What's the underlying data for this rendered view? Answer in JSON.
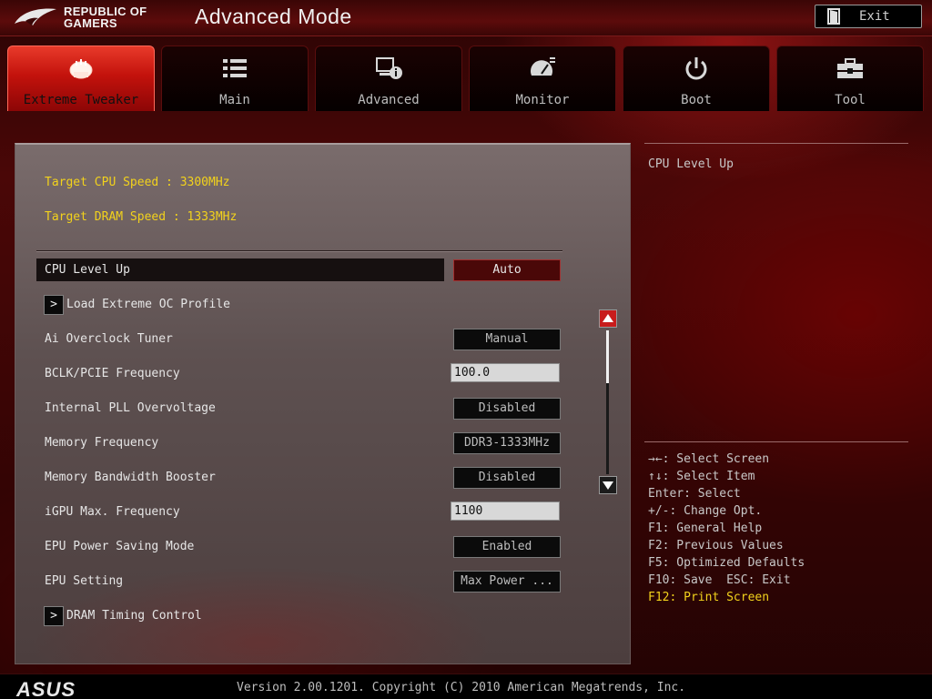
{
  "header": {
    "brand_line1": "REPUBLIC OF",
    "brand_line2": "GAMERS",
    "mode_title": "Advanced Mode",
    "exit_label": "Exit"
  },
  "tabs": [
    {
      "label": "Extreme Tweaker",
      "icon": "tweaker-icon",
      "active": true
    },
    {
      "label": "Main",
      "icon": "list-icon",
      "active": false
    },
    {
      "label": "Advanced",
      "icon": "advanced-info-icon",
      "active": false
    },
    {
      "label": "Monitor",
      "icon": "gauge-icon",
      "active": false
    },
    {
      "label": "Boot",
      "icon": "power-icon",
      "active": false
    },
    {
      "label": "Tool",
      "icon": "toolbox-icon",
      "active": false
    }
  ],
  "main": {
    "target_cpu": "Target CPU Speed : 3300MHz",
    "target_dram": "Target DRAM Speed : 1333MHz",
    "rows": [
      {
        "label": "CPU Level Up",
        "value": "Auto",
        "kind": "option",
        "selected": true
      },
      {
        "label": "Load Extreme OC Profile",
        "kind": "submenu"
      },
      {
        "label": "Ai Overclock Tuner",
        "value": "Manual",
        "kind": "option"
      },
      {
        "label": "BCLK/PCIE Frequency",
        "value": "100.0",
        "kind": "field"
      },
      {
        "label": "Internal PLL Overvoltage",
        "value": "Disabled",
        "kind": "option"
      },
      {
        "label": "Memory Frequency",
        "value": "DDR3-1333MHz",
        "kind": "option"
      },
      {
        "label": "Memory Bandwidth Booster",
        "value": "Disabled",
        "kind": "option"
      },
      {
        "label": "iGPU Max. Frequency",
        "value": "1100",
        "kind": "field"
      },
      {
        "label": "EPU Power Saving Mode",
        "value": "Enabled",
        "kind": "option"
      },
      {
        "label": "EPU Setting",
        "value": "Max Power ...",
        "kind": "option"
      },
      {
        "label": "DRAM Timing Control",
        "kind": "submenu"
      }
    ],
    "submenu_arrow": ">"
  },
  "help": {
    "title": "CPU Level Up",
    "keys": [
      "→←: Select Screen",
      "↑↓: Select Item",
      "Enter: Select",
      "+/-: Change Opt.",
      "F1: General Help",
      "F2: Previous Values",
      "F5: Optimized Defaults",
      "F10: Save  ESC: Exit",
      "F12: Print Screen"
    ]
  },
  "footer": {
    "logo_text": "ASUS",
    "version": "Version 2.00.1201. Copyright (C) 2010 American Megatrends, Inc."
  },
  "colors": {
    "accent_red": "#c3120c",
    "highlight_yellow": "#f2d21c",
    "background": "#3c0505"
  }
}
